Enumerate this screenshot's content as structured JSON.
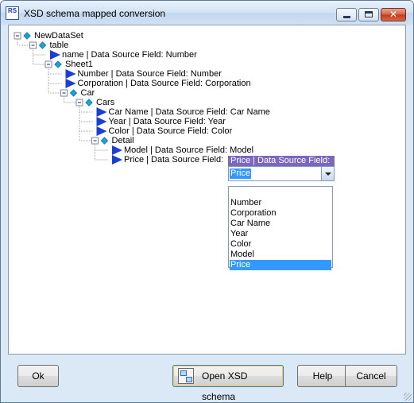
{
  "window": {
    "title": "XSD schema mapped conversion",
    "app_icon_text": "RS"
  },
  "tree": {
    "nodes": [
      {
        "label": "NewDataSet",
        "kind": "element"
      },
      {
        "label": "table",
        "kind": "element"
      },
      {
        "label": "name | Data Source Field: Number",
        "kind": "field"
      },
      {
        "label": "Sheet1",
        "kind": "element"
      },
      {
        "label": "Number | Data Source Field: Number",
        "kind": "field"
      },
      {
        "label": "Corporation | Data Source Field: Corporation",
        "kind": "field"
      },
      {
        "label": "Car",
        "kind": "element"
      },
      {
        "label": "Cars",
        "kind": "element"
      },
      {
        "label": "Car  Name | Data Source Field: Car Name",
        "kind": "field"
      },
      {
        "label": "Year | Data Source Field: Year",
        "kind": "field"
      },
      {
        "label": "Color | Data Source Field: Color",
        "kind": "field"
      },
      {
        "label": "Detail",
        "kind": "element"
      },
      {
        "label": "Model | Data Source Field: Model",
        "kind": "field"
      },
      {
        "label": "Price | Data Source Field:",
        "kind": "field"
      }
    ]
  },
  "field_editor": {
    "label": "Price | Data Source Field:",
    "selected": "Price",
    "options": [
      "",
      "Number",
      "Corporation",
      "Car Name",
      "Year",
      "Color",
      "Model",
      "Price"
    ]
  },
  "buttons": {
    "ok": "Ok",
    "open_xsd": "Open XSD schema",
    "help": "Help",
    "cancel": "Cancel"
  },
  "icons": {
    "element": "diamond-icon",
    "field": "triangle-arrow-icon",
    "expander": "minus-box-icon"
  },
  "colors": {
    "element_icon": "#1aa5d8",
    "field_icon": "#1a3fd6",
    "selection": "#3399ff",
    "editor_label_bg": "#7b66c0"
  }
}
